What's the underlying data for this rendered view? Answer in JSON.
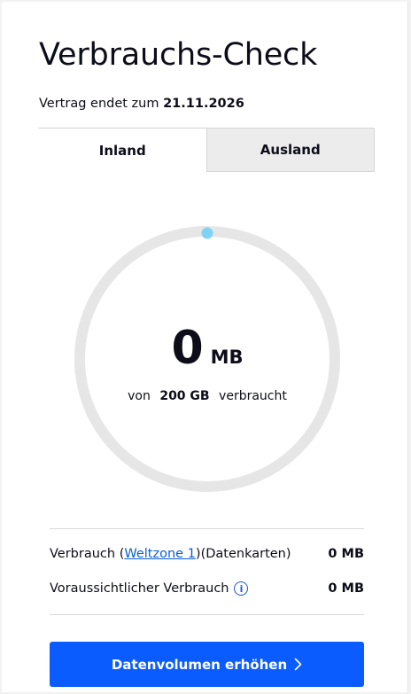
{
  "header": {
    "title": "Verbrauchs-Check",
    "contract_prefix": "Vertrag endet zum",
    "contract_date": "21.11.2026"
  },
  "tabs": [
    {
      "label": "Inland",
      "active": true
    },
    {
      "label": "Ausland",
      "active": false
    }
  ],
  "gauge": {
    "used_value": "0",
    "used_unit": "MB",
    "of_prefix": "von",
    "total": "200 GB",
    "of_suffix": "verbraucht",
    "used_fraction": 0,
    "track_color": "#e6e6e6",
    "indicator_color": "#7fd4f3"
  },
  "details": {
    "row1": {
      "label_prefix": "Verbrauch (",
      "link": "Weltzone 1",
      "label_suffix": ")(Datenkarten)",
      "value": "0 MB"
    },
    "row2": {
      "label": "Voraussichtlicher Verbrauch",
      "info_icon": "i",
      "value": "0 MB"
    }
  },
  "cta": {
    "label": "Datenvolumen erhöhen",
    "color": "#0b5cff"
  }
}
